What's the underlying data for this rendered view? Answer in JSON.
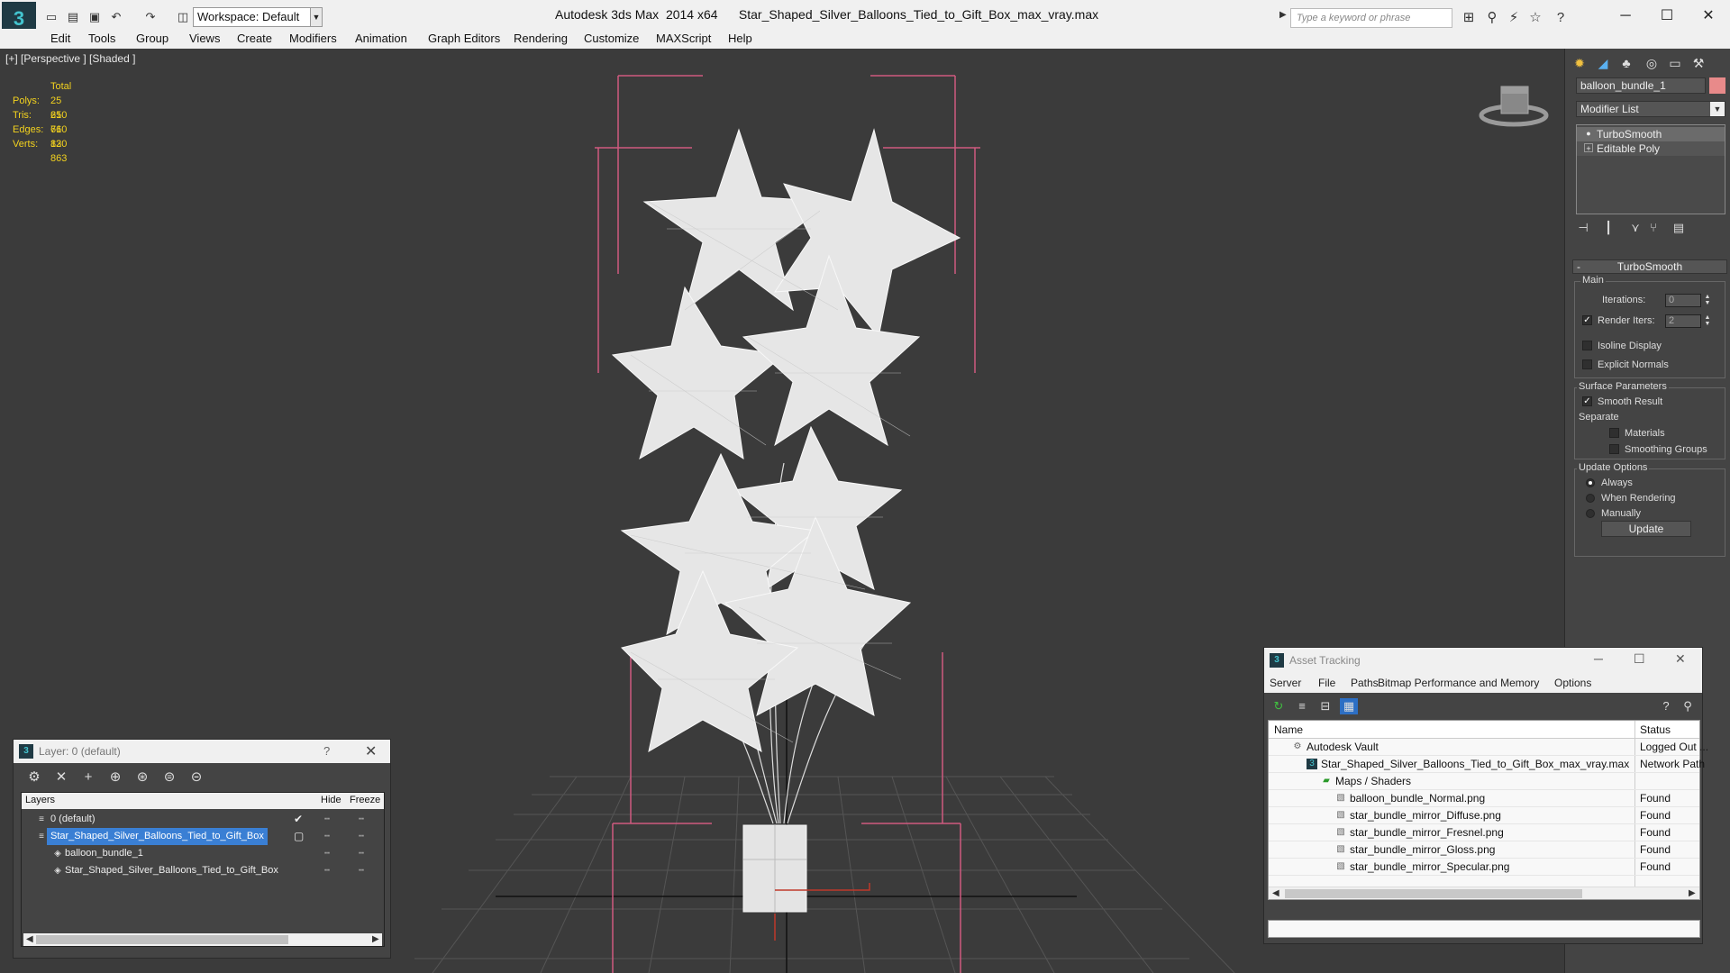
{
  "titlebar": {
    "workspace": "Workspace: Default",
    "window_title": "Autodesk 3ds Max  2014 x64      Star_Shaped_Silver_Balloons_Tied_to_Gift_Box_max_vray.max",
    "search_placeholder": "Type a keyword or phrase"
  },
  "menu": [
    "Edit",
    "Tools",
    "Group",
    "Views",
    "Create",
    "Modifiers",
    "Animation",
    "Graph Editors",
    "Rendering",
    "Customize",
    "MAXScript",
    "Help"
  ],
  "viewport": {
    "label": "[+] [Perspective ] [Shaded ]",
    "stats": {
      "header": "Total",
      "rows": [
        {
          "key": "Polys:",
          "value": "25 610"
        },
        {
          "key": "Tris:",
          "value": "25 610"
        },
        {
          "key": "Edges:",
          "value": "76 830"
        },
        {
          "key": "Verts:",
          "value": "12 863"
        }
      ]
    }
  },
  "command_panel": {
    "object_name": "balloon_bundle_1",
    "object_color": "#e88a8a",
    "modifier_list": "Modifier List",
    "stack": [
      "TurboSmooth",
      "Editable Poly"
    ],
    "rollout_title": "TurboSmooth",
    "main_group": "Main",
    "iterations_label": "Iterations:",
    "iterations_value": "0",
    "render_iters_label": "Render Iters:",
    "render_iters_value": "2",
    "isoline_label": "Isoline Display",
    "explicit_normals_label": "Explicit Normals",
    "surface_group": "Surface Parameters",
    "smooth_result_label": "Smooth Result",
    "separate_label": "Separate",
    "materials_label": "Materials",
    "smoothing_groups_label": "Smoothing Groups",
    "update_group": "Update Options",
    "always_label": "Always",
    "when_rendering_label": "When Rendering",
    "manually_label": "Manually",
    "update_button": "Update"
  },
  "layer_dialog": {
    "title": "Layer: 0 (default)",
    "help": "?",
    "col_layers": "Layers",
    "col_hide": "Hide",
    "col_freeze": "Freeze",
    "rows": [
      {
        "name": "0 (default)"
      },
      {
        "name": "Star_Shaped_Silver_Balloons_Tied_to_Gift_Box"
      },
      {
        "name": "balloon_bundle_1"
      },
      {
        "name": "Star_Shaped_Silver_Balloons_Tied_to_Gift_Box"
      }
    ]
  },
  "asset_dialog": {
    "title": "Asset Tracking",
    "menu": [
      "Server",
      "File",
      "Paths",
      "Bitmap Performance and Memory",
      "Options"
    ],
    "col_name": "Name",
    "col_status": "Status",
    "rows": [
      {
        "name": "Autodesk Vault",
        "status": "Logged Out ..."
      },
      {
        "name": "Star_Shaped_Silver_Balloons_Tied_to_Gift_Box_max_vray.max",
        "status": "Network Path"
      },
      {
        "name": "Maps / Shaders",
        "status": ""
      },
      {
        "name": "balloon_bundle_Normal.png",
        "status": "Found"
      },
      {
        "name": "star_bundle_mirror_Diffuse.png",
        "status": "Found"
      },
      {
        "name": "star_bundle_mirror_Fresnel.png",
        "status": "Found"
      },
      {
        "name": "star_bundle_mirror_Gloss.png",
        "status": "Found"
      },
      {
        "name": "star_bundle_mirror_Specular.png",
        "status": "Found"
      }
    ]
  }
}
